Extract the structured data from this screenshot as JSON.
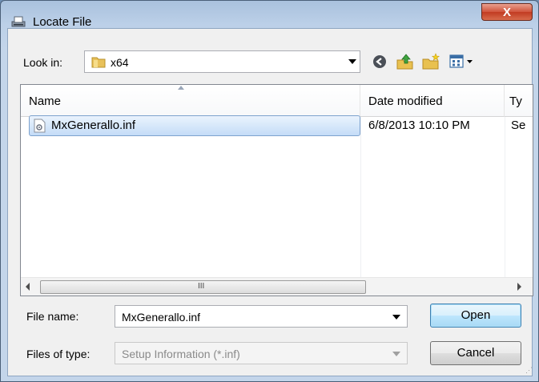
{
  "window": {
    "title": "Locate File",
    "close_label": "X"
  },
  "lookin": {
    "label": "Look in:",
    "value": "x64"
  },
  "toolbar": {
    "icons": [
      "back-icon",
      "up-folder-icon",
      "new-folder-icon",
      "view-menu-icon"
    ]
  },
  "filelist": {
    "columns": [
      "Name",
      "Date modified",
      "Ty"
    ],
    "rows": [
      {
        "name": "MxGenerallo.inf",
        "date": "6/8/2013 10:10 PM",
        "type": "Se"
      }
    ]
  },
  "scrollbar": {
    "grip": "III"
  },
  "filename": {
    "label": "File name:",
    "value": "MxGenerallo.inf"
  },
  "filetype": {
    "label": "Files of type:",
    "value": "Setup Information (*.inf)"
  },
  "buttons": {
    "open": "Open",
    "cancel": "Cancel"
  },
  "colors": {
    "selection": "#cce4f7",
    "title_bg": "#b9d1ea",
    "close_red": "#c7432a"
  }
}
